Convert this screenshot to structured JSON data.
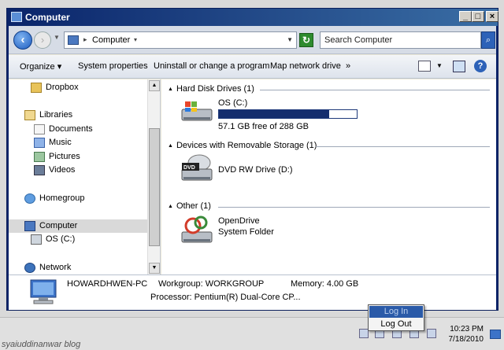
{
  "window": {
    "title": "Computer",
    "controls": {
      "minimize": "_",
      "maximize": "□",
      "close": "×"
    }
  },
  "addressbar": {
    "location": "Computer",
    "search_placeholder": "Search Computer"
  },
  "toolbar": {
    "organize": "Organize ▾",
    "system_properties": "System properties",
    "uninstall": "Uninstall or change a program",
    "map_drive": "Map network drive",
    "more": "»"
  },
  "navpane": {
    "items": [
      {
        "label": "Dropbox",
        "icon": "folder-icon"
      },
      {
        "label": "Libraries",
        "icon": "libraries-icon"
      },
      {
        "label": "Documents",
        "icon": "documents-icon"
      },
      {
        "label": "Music",
        "icon": "music-icon"
      },
      {
        "label": "Pictures",
        "icon": "pictures-icon"
      },
      {
        "label": "Videos",
        "icon": "videos-icon"
      },
      {
        "label": "Homegroup",
        "icon": "homegroup-icon"
      },
      {
        "label": "Computer",
        "icon": "computer-icon"
      },
      {
        "label": "OS (C:)",
        "icon": "drive-icon"
      },
      {
        "label": "Network",
        "icon": "network-icon"
      }
    ]
  },
  "content": {
    "groups": [
      {
        "header": "Hard Disk Drives (1)"
      },
      {
        "header": "Devices with Removable Storage (1)"
      },
      {
        "header": "Other (1)"
      }
    ],
    "hdd": {
      "name": "OS (C:)",
      "free_text": "57.1 GB free of 288 GB",
      "used_fraction": 0.8
    },
    "dvd": {
      "name": "DVD RW Drive (D:)",
      "icon_label": "DVD"
    },
    "opendrive": {
      "name": "OpenDrive",
      "sub": "System Folder"
    }
  },
  "details": {
    "pc_name": "HOWARDHWEN-PC",
    "workgroup": "Workgroup: WORKGROUP",
    "memory": "Memory: 4.00 GB",
    "processor": "Processor: Pentium(R) Dual-Core CP..."
  },
  "popup": {
    "login": "Log In",
    "logout": "Log Out"
  },
  "taskbar": {
    "time": "10:23 PM",
    "date": "7/18/2010",
    "watermark": "syaiuddinanwar blog"
  },
  "colors": {
    "accent": "#0a246a",
    "progress": "#152e6e"
  }
}
